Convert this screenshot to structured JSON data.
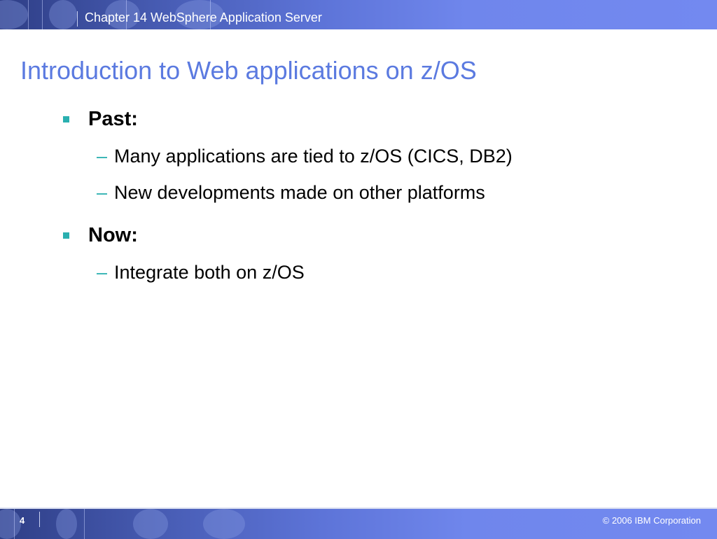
{
  "header": {
    "title": "Chapter 14 WebSphere Application Server"
  },
  "slide": {
    "title": "Introduction to Web applications on z/OS",
    "bullets": [
      {
        "label": "Past:",
        "subs": [
          "Many applications are tied to z/OS (CICS, DB2)",
          "New developments made on other platforms"
        ]
      },
      {
        "label": "Now:",
        "subs": [
          "Integrate both on z/OS"
        ]
      }
    ],
    "dash": "–"
  },
  "footer": {
    "page_number": "4",
    "copyright": "© 2006 IBM Corporation"
  },
  "colors": {
    "accent": "#2ab0b0",
    "title": "#5b7ae0",
    "band": "#7389f0"
  }
}
